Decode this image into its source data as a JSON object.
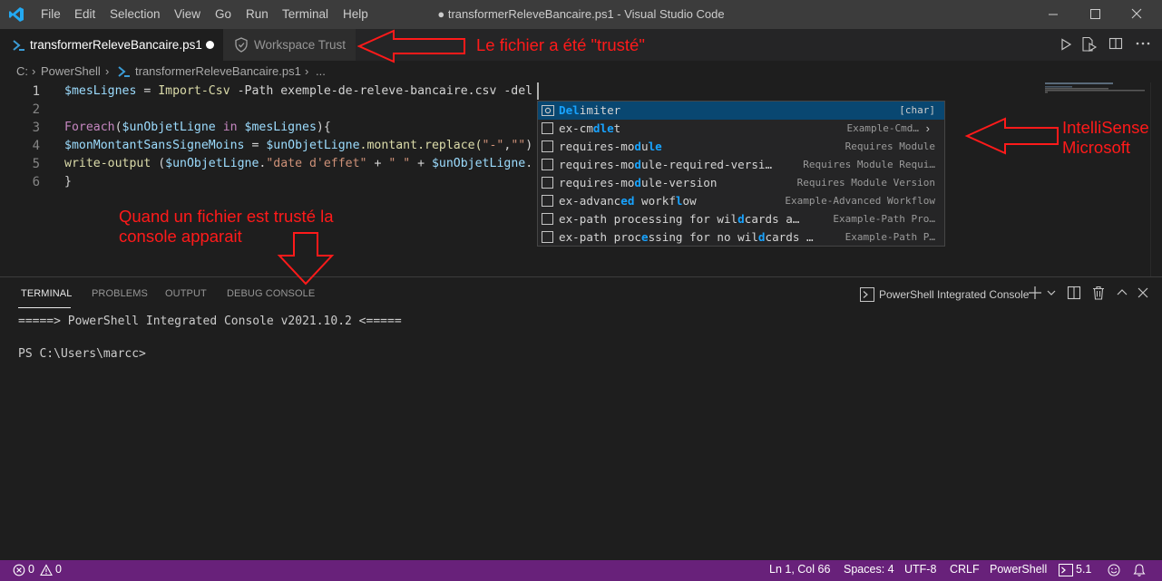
{
  "titlebar": {
    "menu": [
      "File",
      "Edit",
      "Selection",
      "View",
      "Go",
      "Run",
      "Terminal",
      "Help"
    ],
    "title": "● transformerReleveBancaire.ps1 - Visual Studio Code"
  },
  "tabs": {
    "active_label": "transformerReleveBancaire.ps1",
    "workspace_trust_label": "Workspace Trust"
  },
  "breadcrumb": {
    "drive": "C:",
    "folder": "PowerShell",
    "file": "transformerReleveBancaire.ps1",
    "more": "..."
  },
  "editor": {
    "line_numbers": [
      "1",
      "2",
      "3",
      "4",
      "5",
      "6"
    ],
    "lines": {
      "l1_var": "$mesLignes",
      "l1_eq": " = ",
      "l1_cmd": "Import-Csv",
      "l1_rest": " -Path exemple-de-releve-bancaire.csv -del",
      "l3_kw": "Foreach",
      "l3_p1": "(",
      "l3_var1": "$unObjetLigne",
      "l3_in": " in ",
      "l3_var2": "$mesLignes",
      "l3_p2": "){",
      "l4_var1": "$monMontantSansSigneMoins",
      "l4_eq": " = ",
      "l4_var2": "$unObjetLigne",
      "l4_mid": ".montant.replace(",
      "l4_s1": "\"-\"",
      "l4_comma": ",",
      "l4_s2": "\"\"",
      "l4_end": ")",
      "l5_cmd": "write-output",
      "l5_p": " (",
      "l5_var1": "$unObjetLigne",
      "l5_dot": ".",
      "l5_s1": "\"date d'effet\"",
      "l5_plus1": " + ",
      "l5_s2": "\" \"",
      "l5_plus2": " + ",
      "l5_var2": "$unObjetLigne",
      "l5_end": ".",
      "l6": "}"
    }
  },
  "suggest": {
    "items": [
      {
        "pre": "",
        "hl1": "Del",
        "mid": "imiter",
        "hl2": "",
        "post": "",
        "detail": "[char]"
      },
      {
        "pre": "ex-cm",
        "hl1": "dle",
        "mid": "t",
        "hl2": "",
        "post": "",
        "detail": "Example-Cmd…"
      },
      {
        "pre": "requires-mo",
        "hl1": "d",
        "mid": "u",
        "hl2": "le",
        "post": "",
        "detail": "Requires Module"
      },
      {
        "pre": "requires-mo",
        "hl1": "d",
        "mid": "ule-required-versi…",
        "hl2": "",
        "post": "",
        "detail": "Requires Module Requi…"
      },
      {
        "pre": "requires-mo",
        "hl1": "d",
        "mid": "ule-version",
        "hl2": "",
        "post": "",
        "detail": "Requires Module Version"
      },
      {
        "pre": "ex-advanc",
        "hl1": "ed",
        "mid": " workf",
        "hl2": "l",
        "post": "ow",
        "detail": "Example-Advanced Workflow"
      },
      {
        "pre": "ex-path processing for wil",
        "hl1": "d",
        "mid": "cards a…",
        "hl2": "",
        "post": "",
        "detail": "Example-Path Pro…"
      },
      {
        "pre": "ex-path proc",
        "hl1": "e",
        "mid": "ssing for no wil",
        "hl2": "d",
        "post": "cards …",
        "detail": "Example-Path P…"
      }
    ]
  },
  "panel": {
    "tabs": [
      "TERMINAL",
      "PROBLEMS",
      "OUTPUT",
      "DEBUG CONSOLE"
    ],
    "shell_select": "PowerShell Integrated Console",
    "terminal_lines": [
      "=====> PowerShell Integrated Console v2021.10.2 <=====",
      "PS C:\\Users\\marcc>"
    ]
  },
  "statusbar": {
    "errors": "0",
    "warnings": "0",
    "position": "Ln 1, Col 66",
    "spaces": "Spaces: 4",
    "encoding": "UTF-8",
    "eol": "CRLF",
    "language": "PowerShell",
    "ps_version": "5.1"
  },
  "annotations": {
    "trusted": "Le fichier a été \"trusté\"",
    "intellisense_1": "IntelliSense",
    "intellisense_2": "Microsoft",
    "console_1": "Quand un fichier est trusté la",
    "console_2": "console apparait"
  },
  "colors": {
    "statusbar": "#68217a",
    "annotation": "#ff1a1a",
    "selection": "#094771",
    "match_highlight": "#18a3ff"
  }
}
